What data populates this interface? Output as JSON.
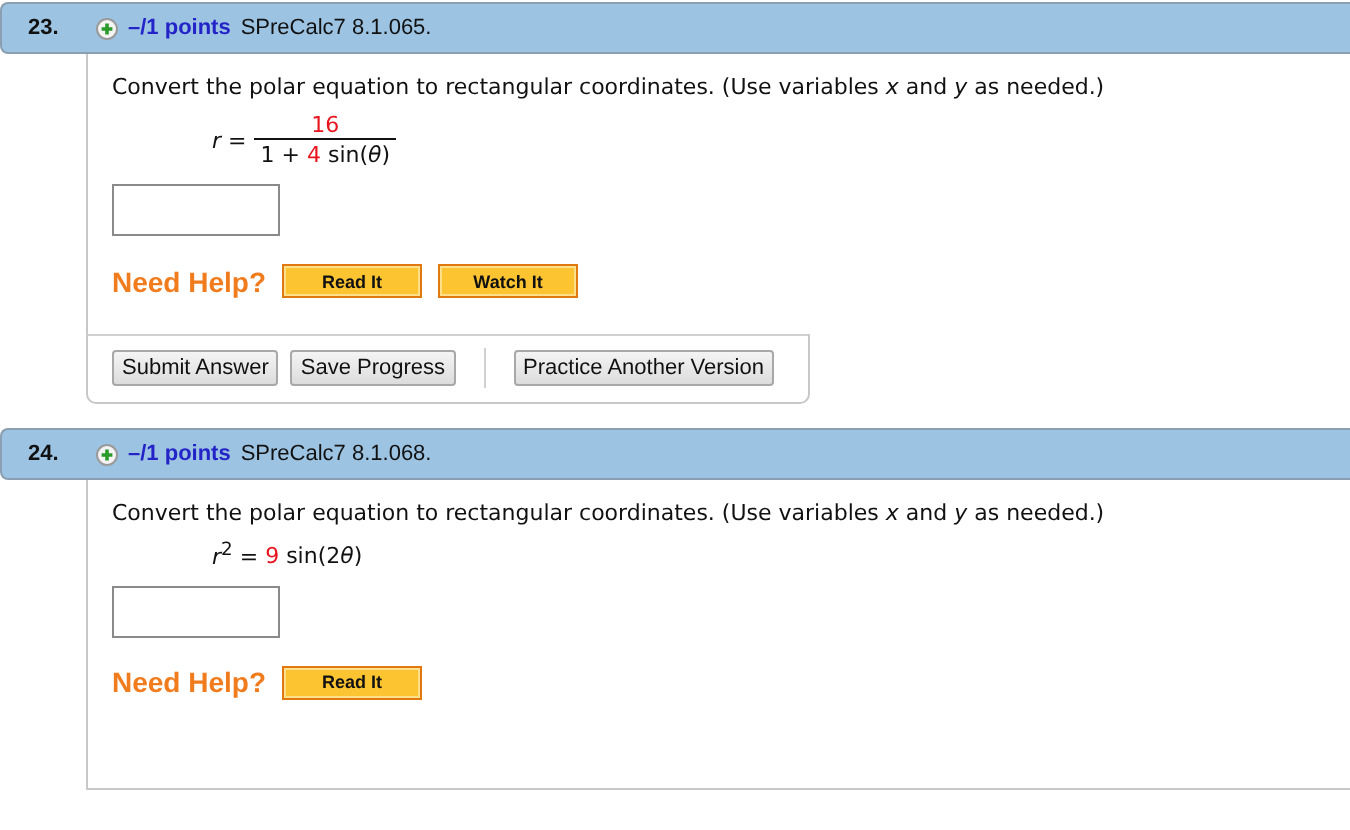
{
  "questions": [
    {
      "number": "23.",
      "points": "–/1 points",
      "source": "SPreCalc7 8.1.065.",
      "prompt": "Convert the polar equation to rectangular coordinates. (Use variables *x* and *y* as needed.)",
      "equation": {
        "kind": "fraction",
        "lhs": [
          {
            "text": "*r* =",
            "highlight": false
          }
        ],
        "numerator": [
          {
            "text": "16",
            "highlight": true
          }
        ],
        "denominator": [
          {
            "text": "1 + ",
            "highlight": false
          },
          {
            "text": "4",
            "highlight": true
          },
          {
            "text": " sin(*θ*)",
            "highlight": false
          }
        ]
      },
      "help_label": "Need Help?",
      "help_buttons": [
        "Read It",
        "Watch It"
      ],
      "actions": [
        "Submit Answer",
        "Save Progress",
        "Practice Another Version"
      ]
    },
    {
      "number": "24.",
      "points": "–/1 points",
      "source": "SPreCalc7 8.1.068.",
      "prompt": "Convert the polar equation to rectangular coordinates. (Use variables *x* and *y* as needed.)",
      "equation": {
        "kind": "inline",
        "lhs": [
          {
            "text": "*r*$^{2}$ = ",
            "highlight": false
          },
          {
            "text": "9",
            "highlight": true
          },
          {
            "text": " sin(2",
            "highlight": false
          },
          {
            "text": "*θ*)",
            "highlight": false
          }
        ]
      },
      "help_label": "Need Help?",
      "help_buttons": [
        "Read It"
      ]
    }
  ]
}
